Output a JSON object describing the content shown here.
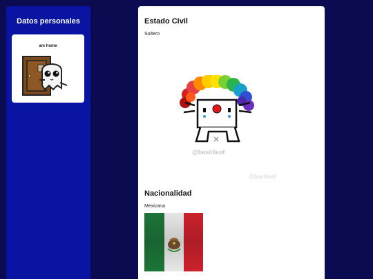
{
  "sidebar": {
    "title": "Datos personales",
    "card_caption": "am home"
  },
  "main": {
    "civil_status": {
      "heading": "Estado Civil",
      "value": "Soltero",
      "watermark_primary": "@basiilleaf",
      "watermark_secondary": "@basiileaf"
    },
    "nationality": {
      "heading": "Nacionalidad",
      "value": "Mexicana"
    }
  },
  "colors": {
    "page_bg": "#0b0b52",
    "sidebar_bg": "#0a14a3",
    "card_bg": "#ffffff",
    "flag_green": "#1e7a3a",
    "flag_red": "#d4232f"
  }
}
